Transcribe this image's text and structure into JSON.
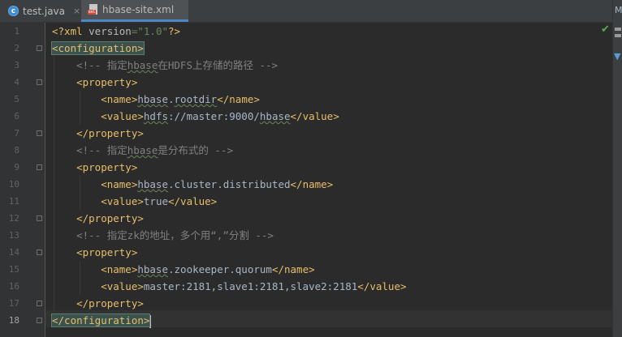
{
  "tabs": [
    {
      "label": "test.java",
      "icon": "java-class-icon",
      "close": "×"
    },
    {
      "label": "hbase-site.xml",
      "icon": "xml-file-icon",
      "close": "×"
    }
  ],
  "rightbar": {
    "label": "M"
  },
  "status": {
    "check": "✔"
  },
  "editor": {
    "current_line": 18,
    "line_numbers": [
      "1",
      "2",
      "3",
      "4",
      "5",
      "6",
      "7",
      "8",
      "9",
      "10",
      "11",
      "12",
      "13",
      "14",
      "15",
      "16",
      "17",
      "18"
    ],
    "lines": [
      [
        {
          "t": "<?xml ",
          "c": "tag"
        },
        {
          "t": "version",
          "c": "attr"
        },
        {
          "t": "=\"1.0\"",
          "c": "val"
        },
        {
          "t": "?>",
          "c": "tag"
        }
      ],
      [
        {
          "t": "<configuration>",
          "c": "tag hl"
        }
      ],
      [
        {
          "t": "    <!-- 指定",
          "c": "cmt"
        },
        {
          "t": "hbase",
          "c": "cmt sq"
        },
        {
          "t": "在HDFS上存储的路径 -->",
          "c": "cmt"
        }
      ],
      [
        {
          "t": "    <property>",
          "c": "tag"
        }
      ],
      [
        {
          "t": "        <name>",
          "c": "tag"
        },
        {
          "t": "hbase",
          "c": "sq"
        },
        {
          "t": "."
        },
        {
          "t": "rootdir",
          "c": "sq"
        },
        {
          "t": "</name>",
          "c": "tag"
        }
      ],
      [
        {
          "t": "        <value>",
          "c": "tag"
        },
        {
          "t": "hdfs",
          "c": "sq"
        },
        {
          "t": "://master:9000/"
        },
        {
          "t": "hbase",
          "c": "sq"
        },
        {
          "t": "</value>",
          "c": "tag"
        }
      ],
      [
        {
          "t": "    </property>",
          "c": "tag"
        }
      ],
      [
        {
          "t": "    <!-- 指定",
          "c": "cmt"
        },
        {
          "t": "hbase",
          "c": "cmt sq"
        },
        {
          "t": "是分布式的 -->",
          "c": "cmt"
        }
      ],
      [
        {
          "t": "    <property>",
          "c": "tag"
        }
      ],
      [
        {
          "t": "        <name>",
          "c": "tag"
        },
        {
          "t": "hbase",
          "c": "sq"
        },
        {
          "t": ".cluster.distributed"
        },
        {
          "t": "</name>",
          "c": "tag"
        }
      ],
      [
        {
          "t": "        <value>",
          "c": "tag"
        },
        {
          "t": "true"
        },
        {
          "t": "</value>",
          "c": "tag"
        }
      ],
      [
        {
          "t": "    </property>",
          "c": "tag"
        }
      ],
      [
        {
          "t": "    <!-- 指定zk的地址，多个用“,”分割 -->",
          "c": "cmt"
        }
      ],
      [
        {
          "t": "    <property>",
          "c": "tag"
        }
      ],
      [
        {
          "t": "        <name>",
          "c": "tag"
        },
        {
          "t": "hbase",
          "c": "sq"
        },
        {
          "t": ".zookeeper.quorum"
        },
        {
          "t": "</name>",
          "c": "tag"
        }
      ],
      [
        {
          "t": "        <value>",
          "c": "tag"
        },
        {
          "t": "master:2181,slave1:2181,slave2:2181"
        },
        {
          "t": "</value>",
          "c": "tag"
        }
      ],
      [
        {
          "t": "    </property>",
          "c": "tag"
        }
      ],
      [
        {
          "t": "</configuration>",
          "c": "tag hl"
        }
      ]
    ]
  }
}
